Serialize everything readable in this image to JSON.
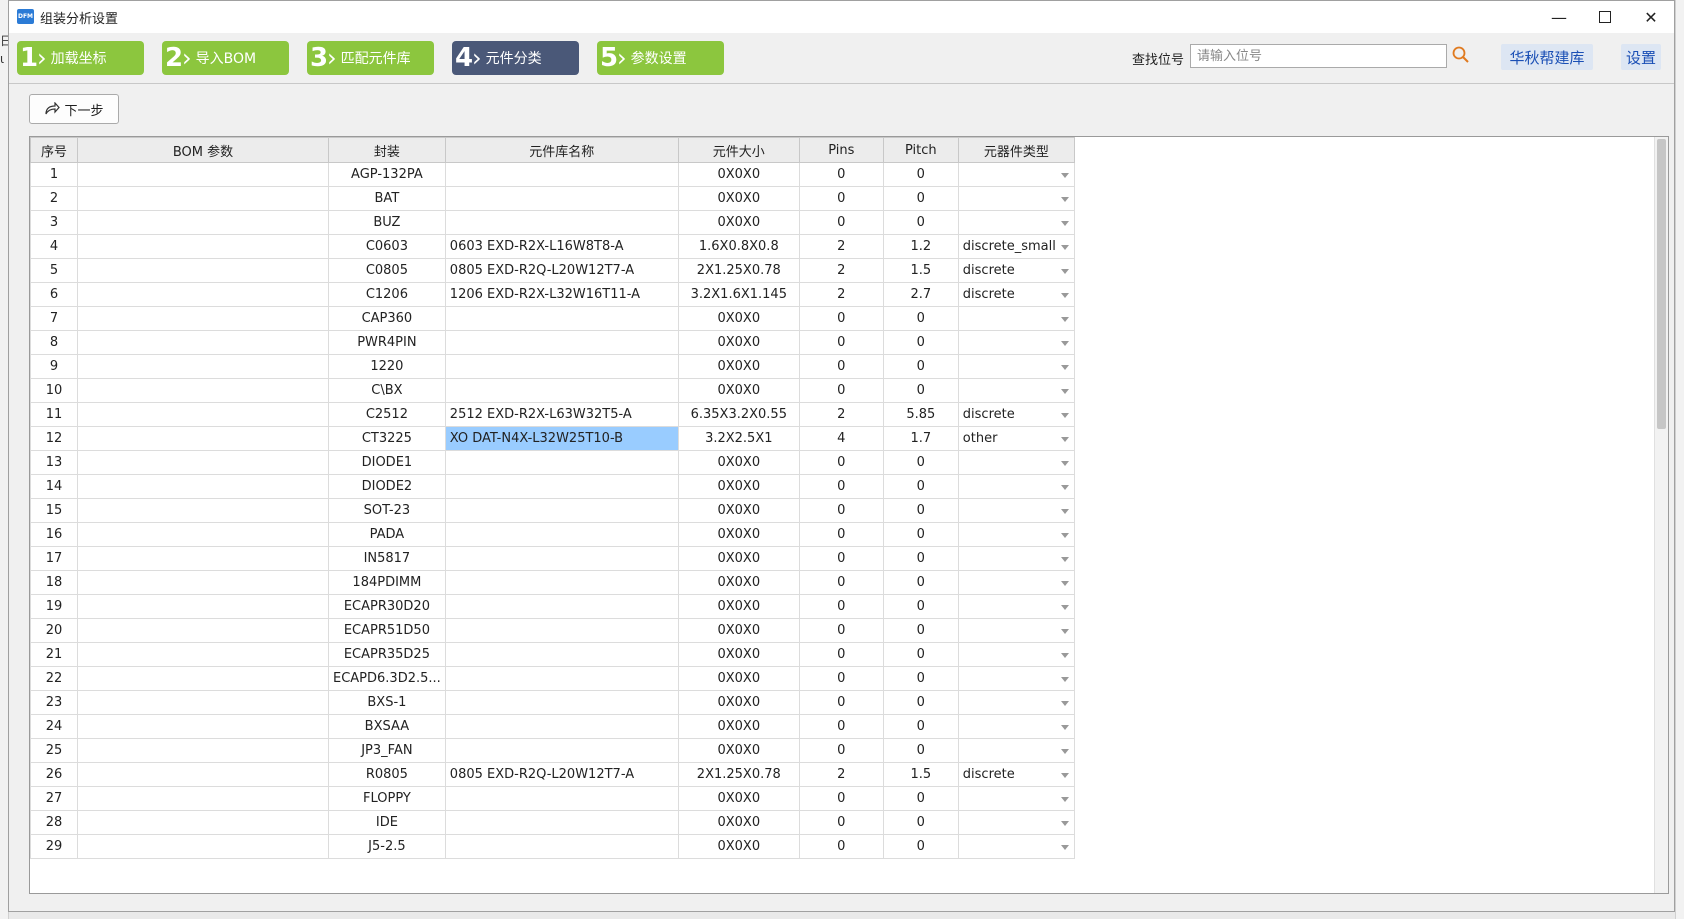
{
  "window": {
    "title": "组装分析设置",
    "icon_text": "DFM",
    "minimize": "—",
    "close": "✕"
  },
  "steps": [
    {
      "num": "1",
      "label": "加载坐标",
      "state": "done"
    },
    {
      "num": "2",
      "label": "导入BOM",
      "state": "done"
    },
    {
      "num": "3",
      "label": "匹配元件库",
      "state": "done"
    },
    {
      "num": "4",
      "label": "元件分类",
      "state": "active"
    },
    {
      "num": "5",
      "label": "参数设置",
      "state": "todo"
    }
  ],
  "colors": {
    "step_green": "#8cc63e",
    "step_active": "#4a5878",
    "selection": "#99ccff",
    "link": "#1a4fb5"
  },
  "search": {
    "label": "查找位号",
    "placeholder": "请输入位号",
    "value": "",
    "icon": "search-icon"
  },
  "header_buttons": {
    "library": "华秋帮建库",
    "settings": "设置"
  },
  "next_button": {
    "label": "下一步",
    "icon": "forward-arrow-icon"
  },
  "background": {
    "left_glyph_1": "日",
    "left_glyph_2": "ι"
  },
  "table": {
    "columns": [
      "序号",
      "BOM 参数",
      "封装",
      "元件库名称",
      "元件大小",
      "Pins",
      "Pitch",
      "元器件类型"
    ],
    "selected_row": 12,
    "rows": [
      [
        "1",
        "",
        "AGP-132PA",
        "",
        "0X0X0",
        "0",
        "0",
        ""
      ],
      [
        "2",
        "",
        "BAT",
        "",
        "0X0X0",
        "0",
        "0",
        ""
      ],
      [
        "3",
        "",
        "BUZ",
        "",
        "0X0X0",
        "0",
        "0",
        ""
      ],
      [
        "4",
        "",
        "C0603",
        "0603 EXD-R2X-L16W8T8-A",
        "1.6X0.8X0.8",
        "2",
        "1.2",
        "discrete_small"
      ],
      [
        "5",
        "",
        "C0805",
        "0805 EXD-R2Q-L20W12T7-A",
        "2X1.25X0.78",
        "2",
        "1.5",
        "discrete"
      ],
      [
        "6",
        "",
        "C1206",
        "1206 EXD-R2X-L32W16T11-A",
        "3.2X1.6X1.145",
        "2",
        "2.7",
        "discrete"
      ],
      [
        "7",
        "",
        "CAP360",
        "",
        "0X0X0",
        "0",
        "0",
        ""
      ],
      [
        "8",
        "",
        "PWR4PIN",
        "",
        "0X0X0",
        "0",
        "0",
        ""
      ],
      [
        "9",
        "",
        "1220",
        "",
        "0X0X0",
        "0",
        "0",
        ""
      ],
      [
        "10",
        "",
        "C\\BX",
        "",
        "0X0X0",
        "0",
        "0",
        ""
      ],
      [
        "11",
        "",
        "C2512",
        "2512 EXD-R2X-L63W32T5-A",
        "6.35X3.2X0.55",
        "2",
        "5.85",
        "discrete"
      ],
      [
        "12",
        "",
        "CT3225",
        "XO DAT-N4X-L32W25T10-B",
        "3.2X2.5X1",
        "4",
        "1.7",
        "other"
      ],
      [
        "13",
        "",
        "DIODE1",
        "",
        "0X0X0",
        "0",
        "0",
        ""
      ],
      [
        "14",
        "",
        "DIODE2",
        "",
        "0X0X0",
        "0",
        "0",
        ""
      ],
      [
        "15",
        "",
        "SOT-23",
        "",
        "0X0X0",
        "0",
        "0",
        ""
      ],
      [
        "16",
        "",
        "PADA",
        "",
        "0X0X0",
        "0",
        "0",
        ""
      ],
      [
        "17",
        "",
        "IN5817",
        "",
        "0X0X0",
        "0",
        "0",
        ""
      ],
      [
        "18",
        "",
        "184PDIMM",
        "",
        "0X0X0",
        "0",
        "0",
        ""
      ],
      [
        "19",
        "",
        "ECAPR30D20",
        "",
        "0X0X0",
        "0",
        "0",
        ""
      ],
      [
        "20",
        "",
        "ECAPR51D50",
        "",
        "0X0X0",
        "0",
        "0",
        ""
      ],
      [
        "21",
        "",
        "ECAPR35D25",
        "",
        "0X0X0",
        "0",
        "0",
        ""
      ],
      [
        "22",
        "",
        "ECAPD6.3D2.5...",
        "",
        "0X0X0",
        "0",
        "0",
        ""
      ],
      [
        "23",
        "",
        "BXS-1",
        "",
        "0X0X0",
        "0",
        "0",
        ""
      ],
      [
        "24",
        "",
        "BXSAA",
        "",
        "0X0X0",
        "0",
        "0",
        ""
      ],
      [
        "25",
        "",
        "JP3_FAN",
        "",
        "0X0X0",
        "0",
        "0",
        ""
      ],
      [
        "26",
        "",
        "R0805",
        "0805 EXD-R2Q-L20W12T7-A",
        "2X1.25X0.78",
        "2",
        "1.5",
        "discrete"
      ],
      [
        "27",
        "",
        "FLOPPY",
        "",
        "0X0X0",
        "0",
        "0",
        ""
      ],
      [
        "28",
        "",
        "IDE",
        "",
        "0X0X0",
        "0",
        "0",
        ""
      ],
      [
        "29",
        "",
        "J5-2.5",
        "",
        "0X0X0",
        "0",
        "0",
        ""
      ]
    ]
  }
}
